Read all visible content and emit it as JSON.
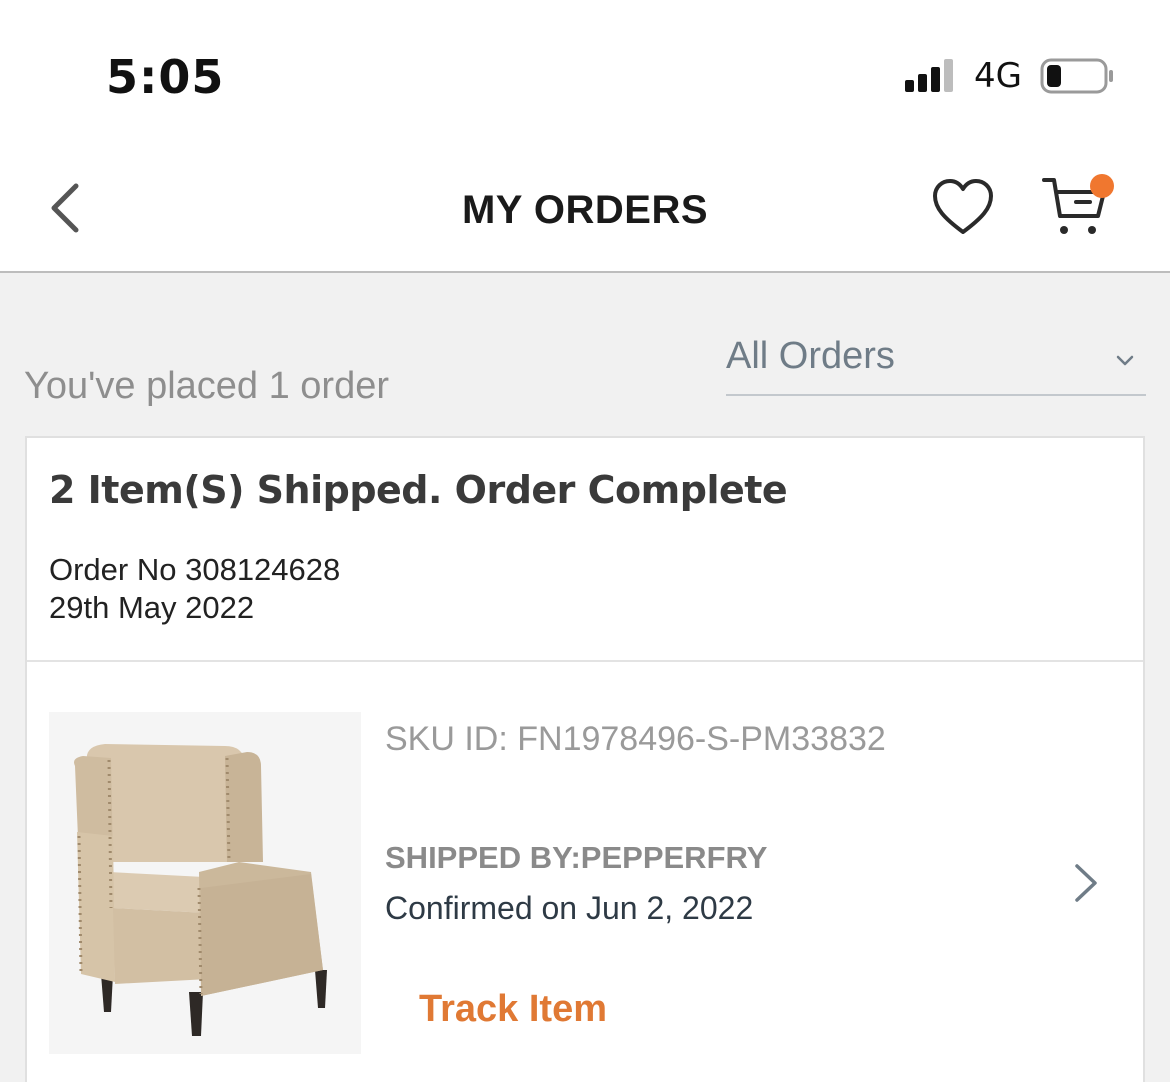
{
  "status_bar": {
    "time": "5:05",
    "network": "4G",
    "icons": [
      "signal-icon",
      "battery-icon"
    ]
  },
  "header": {
    "title": "MY ORDERS",
    "icons": [
      "back-chevron-icon",
      "heart-icon",
      "cart-icon"
    ],
    "cart_badge_color": "#f0772f"
  },
  "summary": {
    "orders_count_text": "You've placed 1 order",
    "filter": {
      "selected": "All Orders"
    }
  },
  "order": {
    "status": "2 Item(S) Shipped. Order Complete",
    "order_no": "Order No 308124628",
    "date": "29th May 2022",
    "item": {
      "image": "armchair-product-image",
      "sku": "SKU ID: FN1978496-S-PM33832",
      "shipped_by": "SHIPPED BY:PEPPERFRY",
      "confirmed": "Confirmed on Jun 2, 2022",
      "track_label": "Track Item"
    }
  },
  "colors": {
    "accent": "#e07934",
    "background": "#f1f1f1"
  }
}
